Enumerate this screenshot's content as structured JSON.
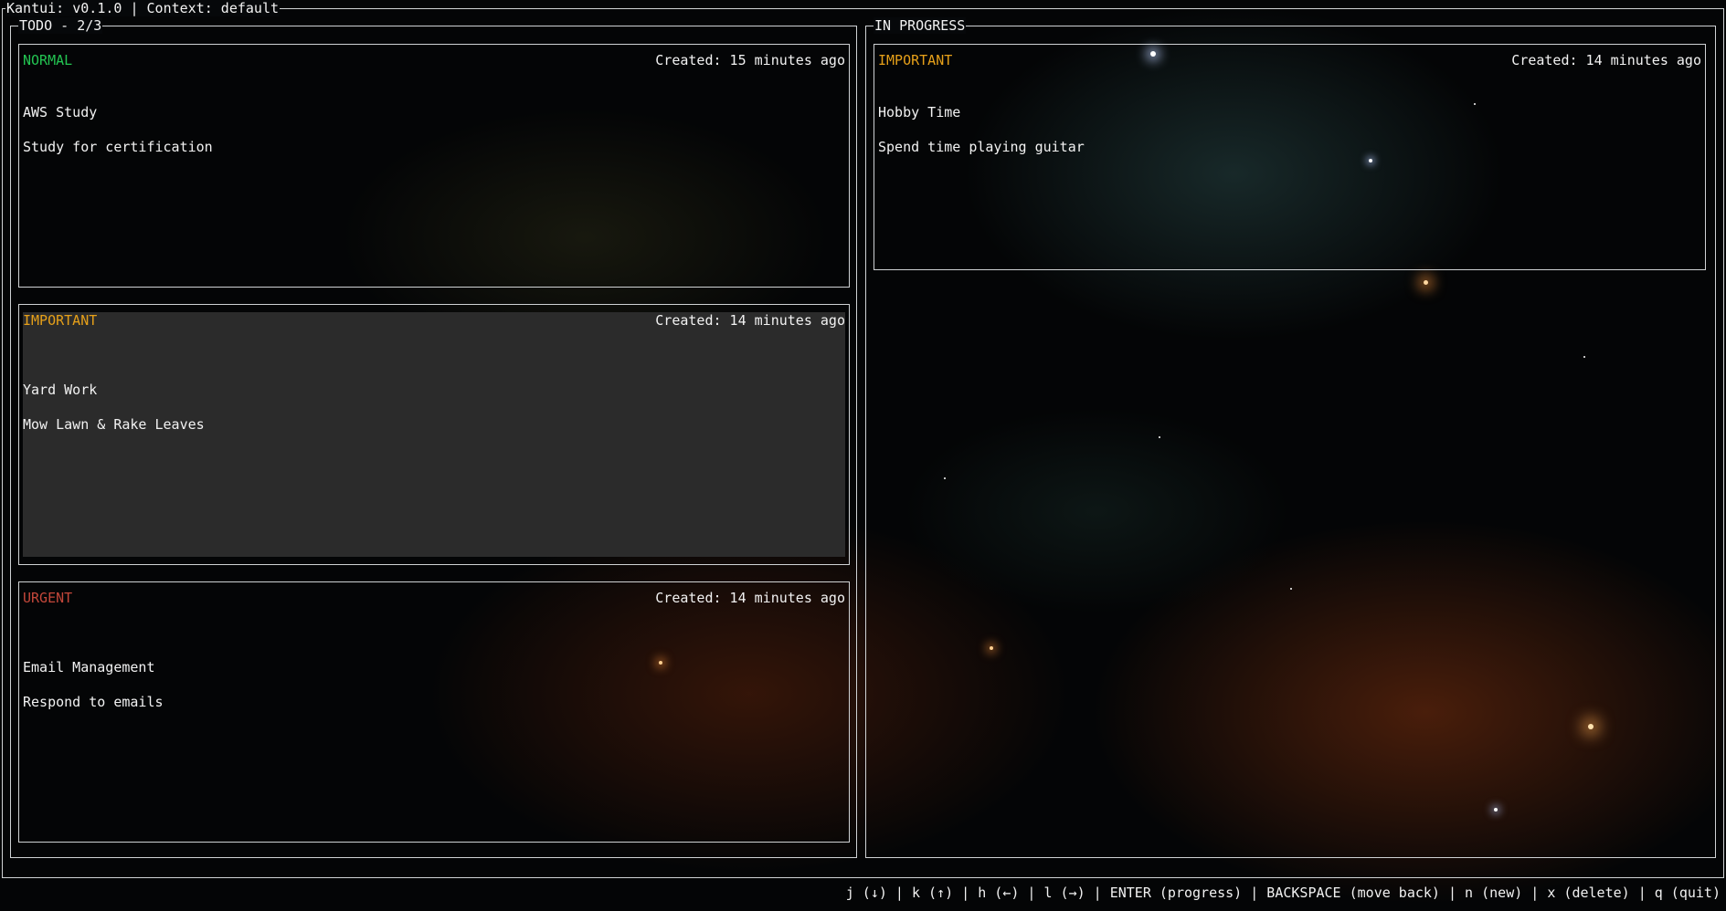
{
  "app": {
    "title": "Kantui: v0.1.0 | Context: default"
  },
  "columns": [
    {
      "title": "TODO - 2/3",
      "cards": [
        {
          "priority": "NORMAL",
          "created": "Created: 15 minutes ago",
          "title": "AWS Study",
          "description": "Study for certification",
          "selected": false
        },
        {
          "priority": "IMPORTANT",
          "created": "Created: 14 minutes ago",
          "title": "Yard Work",
          "description": "Mow Lawn & Rake Leaves",
          "selected": true
        },
        {
          "priority": "URGENT",
          "created": "Created: 14 minutes ago",
          "title": "Email Management",
          "description": "Respond to emails",
          "selected": false
        }
      ]
    },
    {
      "title": "IN PROGRESS",
      "cards": [
        {
          "priority": "IMPORTANT",
          "created": "Created: 14 minutes ago",
          "title": "Hobby Time",
          "description": "Spend time playing guitar",
          "selected": false
        }
      ]
    }
  ],
  "footer": {
    "keybindings": "j (↓) | k (↑) | h (←) | l (→) | ENTER (progress) | BACKSPACE (move back) | n (new) | x (delete) | q (quit)"
  },
  "colors": {
    "normal": "#23c552",
    "important": "#e6a019",
    "urgent": "#c4473a",
    "border": "#cfd2d4",
    "selected_background": "#2b2b2b"
  }
}
